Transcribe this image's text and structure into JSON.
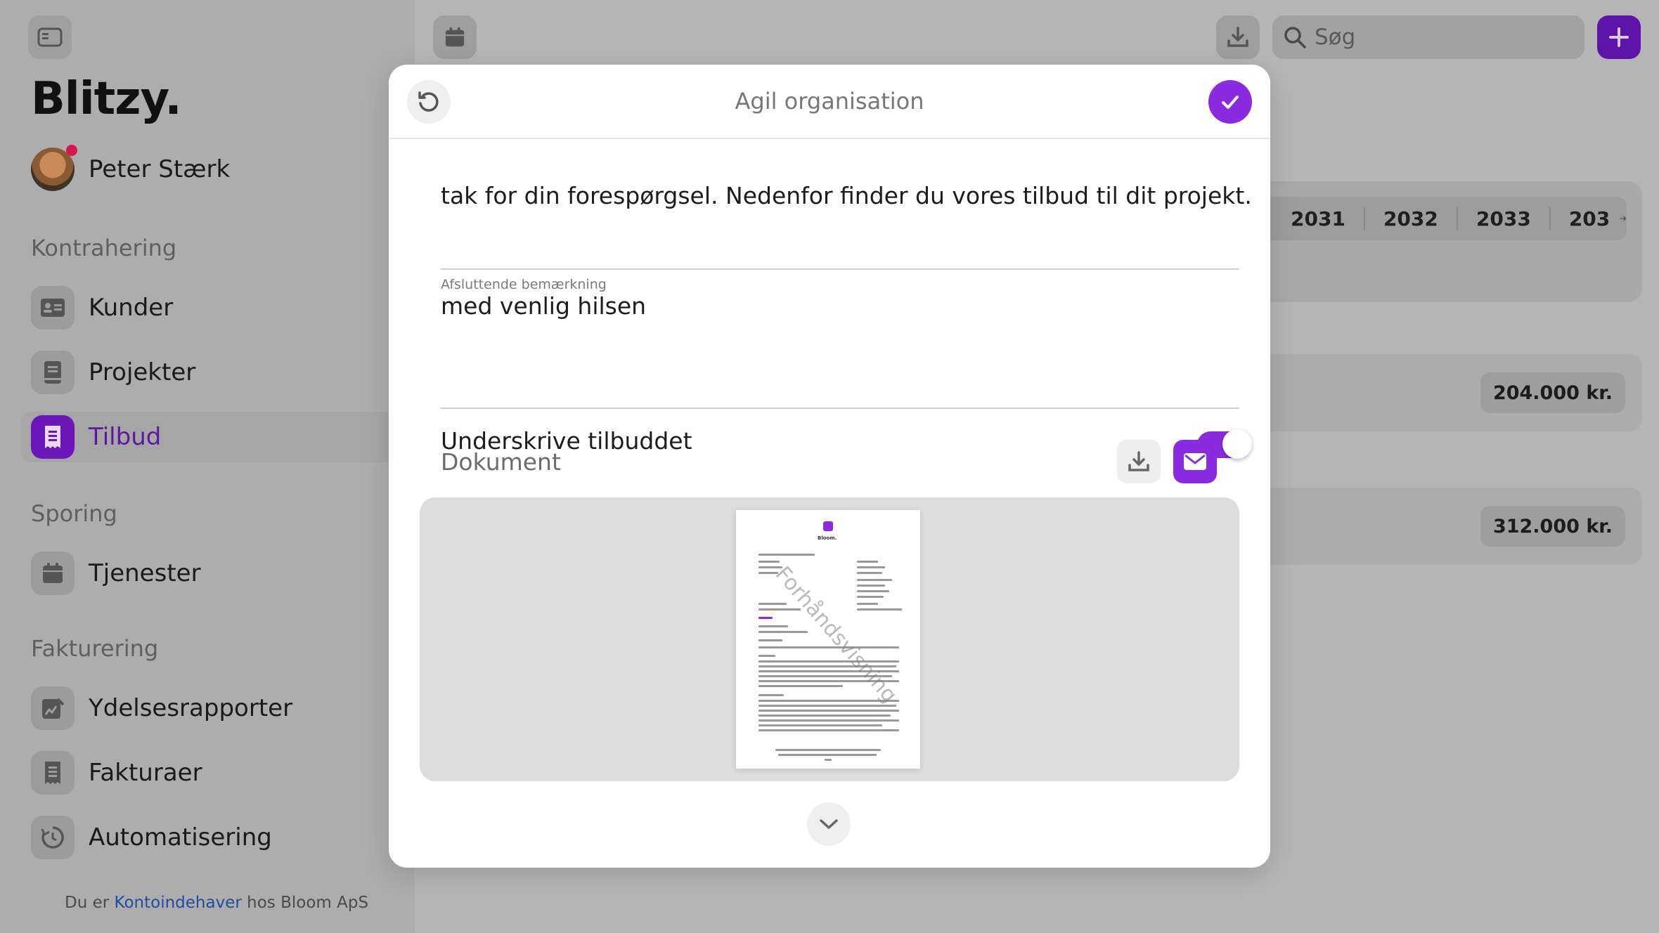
{
  "app": {
    "brand": "Blitzy.",
    "user_name": "Peter Stærk",
    "footer": {
      "prefix": "Du er",
      "link": "Kontoindehaver",
      "suffix": "hos Bloom ApS"
    }
  },
  "sidebar": {
    "sections": [
      {
        "label": "Kontrahering",
        "items": [
          {
            "label": "Kunder",
            "icon": "contact-card-icon"
          },
          {
            "label": "Projekter",
            "icon": "book-icon"
          },
          {
            "label": "Tilbud",
            "icon": "receipt-icon",
            "active": true
          }
        ]
      },
      {
        "label": "Sporing",
        "items": [
          {
            "label": "Tjenester",
            "icon": "calendar-icon"
          }
        ]
      },
      {
        "label": "Fakturering",
        "items": [
          {
            "label": "Ydelsesrapporter",
            "icon": "chart-note-icon"
          },
          {
            "label": "Fakturaer",
            "icon": "invoice-icon"
          },
          {
            "label": "Automatisering",
            "icon": "clock-refresh-icon"
          }
        ]
      }
    ]
  },
  "topbar": {
    "search_placeholder": "Søg"
  },
  "timeline": {
    "years": [
      "2031",
      "2032",
      "2033",
      "203"
    ],
    "amounts": [
      "204.000 kr.",
      "312.000 kr."
    ]
  },
  "modal": {
    "title": "Agil organisation",
    "intro_text": "tak for din forespørgsel. Nedenfor finder du vores tilbud til dit projekt.",
    "closing_label": "Afsluttende bemærkning",
    "closing_value": "med venlig hilsen",
    "sign_label": "Underskrive tilbuddet",
    "sign_enabled": true,
    "document_label": "Dokument",
    "preview_watermark": "Forhåndsvisning",
    "preview_logo_text": "Bloom."
  },
  "colors": {
    "accent": "#8a2be2",
    "accent_dimmed": "#5e14a8",
    "link": "#1c4ea3",
    "notification": "#d8154f"
  }
}
